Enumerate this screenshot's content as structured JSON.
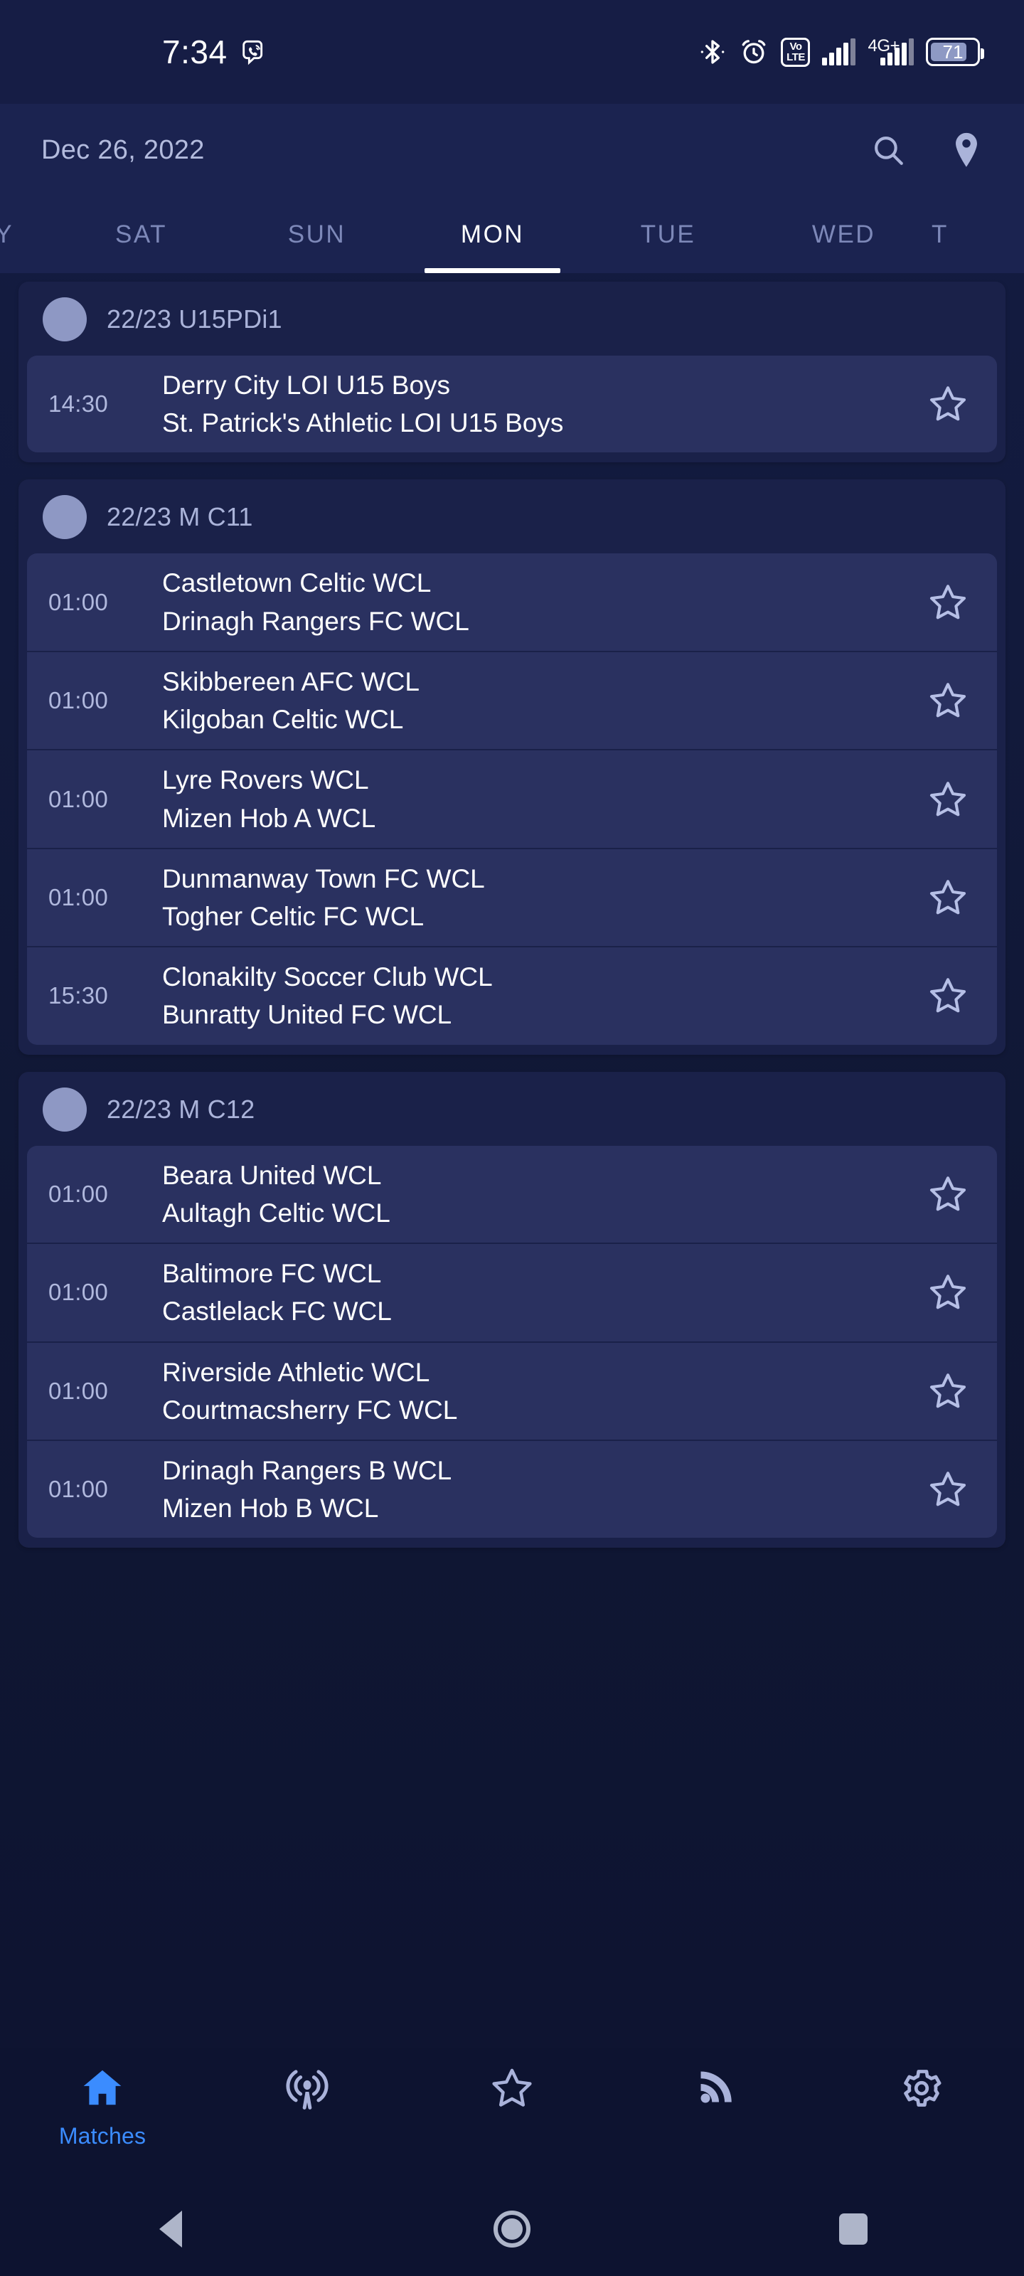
{
  "status_bar": {
    "time": "7:34",
    "app_icon": "viber-phone-icon",
    "bluetooth_icon": "bluetooth-icon",
    "alarm_icon": "alarm-clock-icon",
    "volte_top": "Vo",
    "volte_bottom": "LTE",
    "network_label": "4G+",
    "battery_percent": "71"
  },
  "header": {
    "date": "Dec 26, 2022",
    "search_icon": "search-icon",
    "location_icon": "location-pin-icon"
  },
  "day_tabs": [
    {
      "label": "AY",
      "active": false
    },
    {
      "label": "SAT",
      "active": false
    },
    {
      "label": "SUN",
      "active": false
    },
    {
      "label": "MON",
      "active": true
    },
    {
      "label": "TUE",
      "active": false
    },
    {
      "label": "WED",
      "active": false
    },
    {
      "label": "T",
      "active": false
    }
  ],
  "leagues": [
    {
      "name": "22/23 U15PDi1",
      "matches": [
        {
          "time": "14:30",
          "home": "Derry City LOI U15 Boys",
          "away": "St. Patrick's Athletic LOI U15 Boys"
        }
      ]
    },
    {
      "name": "22/23 M C11",
      "matches": [
        {
          "time": "01:00",
          "home": "Castletown Celtic WCL",
          "away": "Drinagh Rangers FC WCL"
        },
        {
          "time": "01:00",
          "home": "Skibbereen AFC WCL",
          "away": "Kilgoban Celtic WCL"
        },
        {
          "time": "01:00",
          "home": "Lyre Rovers WCL",
          "away": "Mizen Hob A WCL"
        },
        {
          "time": "01:00",
          "home": "Dunmanway Town FC WCL",
          "away": "Togher Celtic FC WCL"
        },
        {
          "time": "15:30",
          "home": "Clonakilty Soccer Club WCL",
          "away": "Bunratty United FC WCL"
        }
      ]
    },
    {
      "name": "22/23 M C12",
      "matches": [
        {
          "time": "01:00",
          "home": "Beara United WCL",
          "away": "Aultagh Celtic WCL"
        },
        {
          "time": "01:00",
          "home": "Baltimore FC WCL",
          "away": "Castlelack FC WCL"
        },
        {
          "time": "01:00",
          "home": "Riverside Athletic WCL",
          "away": "Courtmacsherry FC WCL"
        },
        {
          "time": "01:00",
          "home": "Drinagh Rangers B WCL",
          "away": "Mizen Hob B WCL"
        }
      ]
    }
  ],
  "bottom_nav": [
    {
      "icon": "home-icon",
      "label": "Matches",
      "active": true
    },
    {
      "icon": "live-broadcast-icon",
      "label": "",
      "active": false
    },
    {
      "icon": "star-icon",
      "label": "",
      "active": false
    },
    {
      "icon": "rss-feed-icon",
      "label": "",
      "active": false
    },
    {
      "icon": "settings-gear-icon",
      "label": "",
      "active": false
    }
  ],
  "android_nav": {
    "back_icon": "back-triangle-icon",
    "home_icon": "home-circle-icon",
    "recents_icon": "recents-square-icon"
  },
  "colors": {
    "accent": "#3b8cff",
    "page_bg": "#0d1330",
    "card_bg": "#1a2149",
    "row_bg": "#2a3160",
    "muted_text": "#aab3d9"
  }
}
